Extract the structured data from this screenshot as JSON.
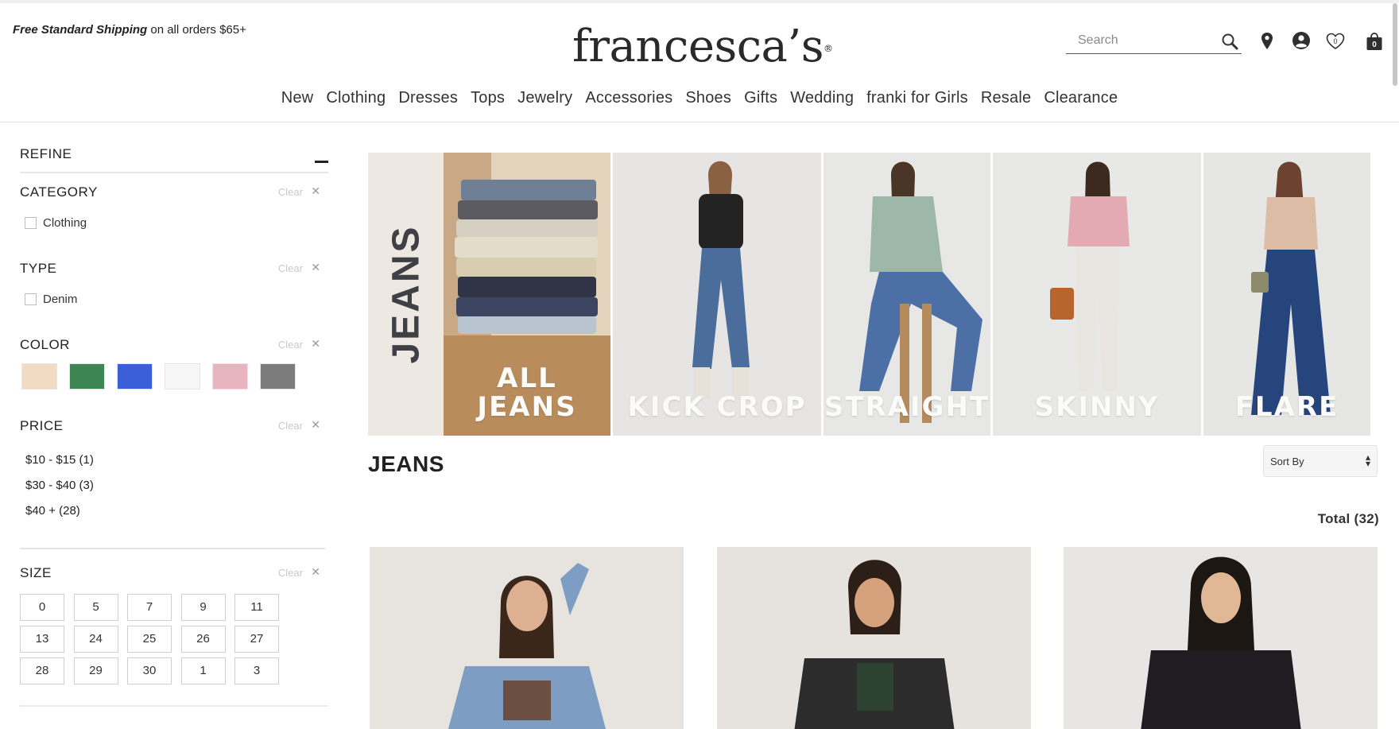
{
  "header": {
    "promo_bold": "Free Standard Shipping",
    "promo_rest": " on all orders $65+",
    "logo": "francesca’s",
    "logo_mark": "®",
    "search_placeholder": "Search",
    "bag_count": "0",
    "wishlist_count": "0"
  },
  "nav": {
    "items": [
      "New",
      "Clothing",
      "Dresses",
      "Tops",
      "Jewelry",
      "Accessories",
      "Shoes",
      "Gifts",
      "Wedding",
      "franki for Girls",
      "Resale",
      "Clearance"
    ]
  },
  "sidebar": {
    "refine": "REFINE",
    "clear": "Clear",
    "category": {
      "title": "CATEGORY",
      "options": [
        "Clothing"
      ]
    },
    "type": {
      "title": "TYPE",
      "options": [
        "Denim"
      ]
    },
    "color": {
      "title": "COLOR",
      "swatches": [
        "#f1dbc2",
        "#3e8554",
        "#3a5fd6",
        "#f7f7f7",
        "#e8b4c0",
        "#7c7c7c"
      ]
    },
    "price": {
      "title": "PRICE",
      "options": [
        "$10 - $15 (1)",
        "$30 - $40 (3)",
        "$40 + (28)"
      ]
    },
    "size": {
      "title": "SIZE",
      "options": [
        "0",
        "5",
        "7",
        "9",
        "11",
        "13",
        "24",
        "25",
        "26",
        "27",
        "28",
        "29",
        "30",
        "1",
        "3"
      ]
    }
  },
  "banner": {
    "side_title": "JEANS",
    "panels": [
      {
        "line1": "ALL",
        "line2": "JEANS"
      },
      {
        "line1": "KICK CROP",
        "line2": ""
      },
      {
        "line1": "STRAIGHT",
        "line2": ""
      },
      {
        "line1": "SKINNY",
        "line2": ""
      },
      {
        "line1": "FLARE",
        "line2": ""
      }
    ]
  },
  "listing": {
    "heading": "JEANS",
    "sort_label": "Sort By",
    "total": "Total (32)"
  }
}
